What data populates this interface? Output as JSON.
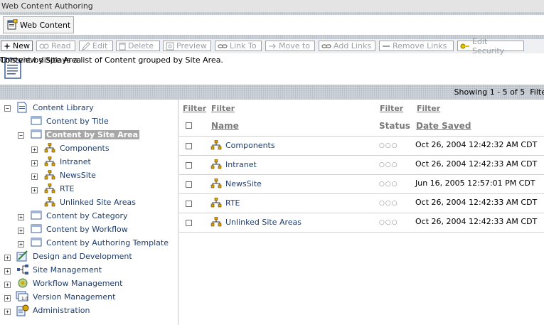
{
  "window": {
    "title": "Web Content Authoring"
  },
  "tab": {
    "label": "Web Content"
  },
  "toolbar": {
    "buttons": [
      {
        "label": "New",
        "active": true
      },
      {
        "label": "Read",
        "active": false
      },
      {
        "label": "Edit",
        "active": false
      },
      {
        "label": "Delete",
        "active": false
      },
      {
        "label": "Preview",
        "active": false
      },
      {
        "label": "Link To",
        "active": false
      },
      {
        "label": "Move to",
        "active": false
      },
      {
        "label": "Add Links",
        "active": false
      },
      {
        "label": "Remove Links",
        "active": false
      },
      {
        "label": "Edit Security",
        "active": false
      }
    ]
  },
  "view": {
    "title": "Content by Site Area",
    "description": "This view displays a list of Content grouped by Site Area."
  },
  "paging": {
    "showing": "Showing 1 - 5 of 5",
    "filter_truncated": "Filte"
  },
  "tree": {
    "items": [
      {
        "label": "Content Library",
        "expander": "-",
        "icon": "library-icon"
      },
      {
        "label": "Content by Title",
        "expander": "",
        "icon": "view-icon"
      },
      {
        "label": "Content by Site Area",
        "expander": "-",
        "icon": "view-icon",
        "selected": true
      },
      {
        "label": "Components",
        "expander": "+",
        "icon": "site-area-icon"
      },
      {
        "label": "Intranet",
        "expander": "+",
        "icon": "site-area-icon"
      },
      {
        "label": "NewsSite",
        "expander": "+",
        "icon": "site-area-icon"
      },
      {
        "label": "RTE",
        "expander": "+",
        "icon": "site-area-icon"
      },
      {
        "label": "Unlinked Site Areas",
        "expander": "",
        "icon": "site-area-icon"
      },
      {
        "label": "Content by Category",
        "expander": "+",
        "icon": "view-icon"
      },
      {
        "label": "Content by Workflow",
        "expander": "+",
        "icon": "view-icon"
      },
      {
        "label": "Content by Authoring Template",
        "expander": "+",
        "icon": "view-icon"
      },
      {
        "label": "Design and Development",
        "expander": "+",
        "icon": "design-icon"
      },
      {
        "label": "Site Management",
        "expander": "+",
        "icon": "site-management-icon"
      },
      {
        "label": "Workflow Management",
        "expander": "+",
        "icon": "workflow-icon"
      },
      {
        "label": "Version Management",
        "expander": "+",
        "icon": "version-icon"
      },
      {
        "label": "Administration",
        "expander": "+",
        "icon": "administration-icon"
      }
    ]
  },
  "table": {
    "filter_label": "Filter",
    "columns": {
      "name": "Name",
      "status": "Status",
      "date": "Date Saved"
    },
    "status_dots": "○○○",
    "rows": [
      {
        "name": "Components",
        "date": "Oct 26, 2004 12:42:32 AM CDT"
      },
      {
        "name": "Intranet",
        "date": "Oct 26, 2004 12:42:33 AM CDT"
      },
      {
        "name": "NewsSite",
        "date": "Jun 16, 2005 12:57:01 PM CDT"
      },
      {
        "name": "RTE",
        "date": "Oct 26, 2004 12:42:33 AM CDT"
      },
      {
        "name": "Unlinked Site Areas",
        "date": "Oct 26, 2004 12:42:33 AM CDT"
      }
    ]
  },
  "colors": {
    "link": "#1f3e6e",
    "band": "#d6dbe0",
    "selected": "#a7a7a7"
  }
}
